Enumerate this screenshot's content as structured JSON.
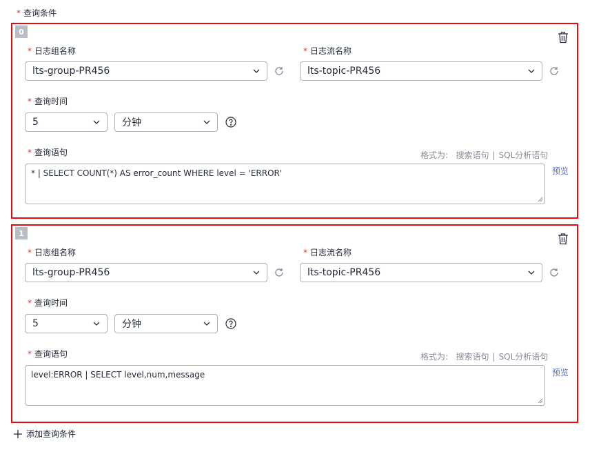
{
  "section": {
    "required_mark": "*",
    "label": "查询条件"
  },
  "conditions": [
    {
      "index": "0",
      "log_group_label": "日志组名称",
      "log_group_value": "lts-group-PR456",
      "log_stream_label": "日志流名称",
      "log_stream_value": "lts-topic-PR456",
      "query_time_label": "查询时间",
      "query_time_value": "5",
      "query_time_unit": "分钟",
      "query_stmt_label": "查询语句",
      "format_prefix": "格式为:",
      "format_search": "搜索语句",
      "format_sep": "|",
      "format_sql": "SQL分析语句",
      "preview": "预览",
      "query_stmt_value": "* | SELECT COUNT(*) AS error_count WHERE level = 'ERROR'"
    },
    {
      "index": "1",
      "log_group_label": "日志组名称",
      "log_group_value": "lts-group-PR456",
      "log_stream_label": "日志流名称",
      "log_stream_value": "lts-topic-PR456",
      "query_time_label": "查询时间",
      "query_time_value": "5",
      "query_time_unit": "分钟",
      "query_stmt_label": "查询语句",
      "format_prefix": "格式为:",
      "format_search": "搜索语句",
      "format_sep": "|",
      "format_sql": "SQL分析语句",
      "preview": "预览",
      "query_stmt_value": "level:ERROR | SELECT level,num,message"
    }
  ],
  "add_condition": {
    "icon": "plus-icon",
    "label": "添加查询条件"
  },
  "colors": {
    "highlight_border": "#e30c0c",
    "required": "#e2302f",
    "link": "#526ecc",
    "index_badge": "#b8bcc4"
  }
}
